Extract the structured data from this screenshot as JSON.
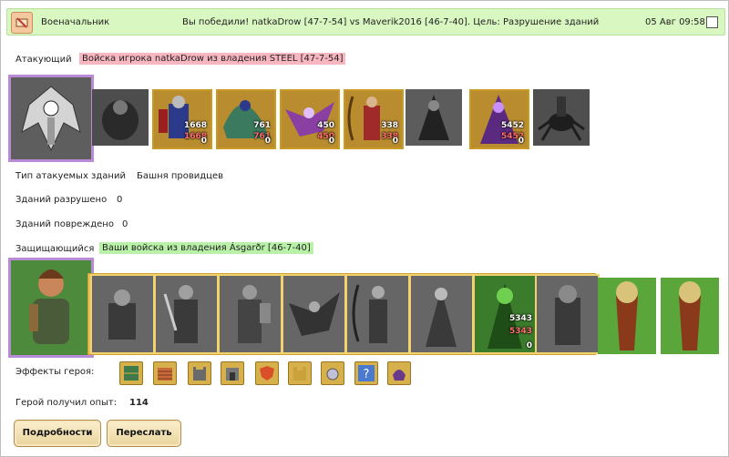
{
  "header": {
    "sender": "Военачальник",
    "subject": "Вы победили! natkaDrow [47-7-54] vs Maverik2016 [46-7-40]. Цель: Разрушение зданий",
    "date": "05 Авг 09:58",
    "icon": "scroll-icon",
    "accent": "#d9f7c0"
  },
  "attacker": {
    "label": "Атакующий",
    "banner": "Войска игрока natkaDrow из владения STEEL [47-7-54]",
    "banner_color": "#f8b6c0",
    "units": [
      {
        "name": "dark-golem",
        "count": null,
        "lost": null,
        "left": null
      },
      {
        "name": "blue-knight",
        "count": "1668",
        "lost": "1668",
        "left": "0"
      },
      {
        "name": "blue-dragon-rider",
        "count": "761",
        "lost": "761",
        "left": "0"
      },
      {
        "name": "purple-griffin",
        "count": "450",
        "lost": "450",
        "left": "0"
      },
      {
        "name": "blue-archer",
        "count": "338",
        "lost": "338",
        "left": "0"
      },
      {
        "name": "dark-monk",
        "count": null,
        "lost": null,
        "left": null
      },
      {
        "name": "purple-mage",
        "count": "5452",
        "lost": "5452",
        "left": "0"
      },
      {
        "name": "dark-spider",
        "count": null,
        "lost": null,
        "left": null
      }
    ]
  },
  "stats": {
    "target_label": "Тип атакуемых зданий",
    "target_value": "Башня провидцев",
    "destroyed_label": "Зданий разрушено",
    "destroyed_value": "0",
    "damaged_label": "Зданий повреждено",
    "damaged_value": "0"
  },
  "defender": {
    "label": "Защищающийся",
    "banner": "Ваши войска из владения Ásgarðr [46-7-40]",
    "banner_color": "#b9f1a9",
    "units": [
      {
        "name": "grey-dwarf",
        "count": null,
        "lost": null,
        "left": null
      },
      {
        "name": "grey-warrior",
        "count": null,
        "lost": null,
        "left": null
      },
      {
        "name": "grey-paladin",
        "count": null,
        "lost": null,
        "left": null
      },
      {
        "name": "grey-griffin",
        "count": null,
        "lost": null,
        "left": null
      },
      {
        "name": "grey-archer",
        "count": null,
        "lost": null,
        "left": null
      },
      {
        "name": "grey-priestess",
        "count": null,
        "lost": null,
        "left": null
      },
      {
        "name": "green-druid",
        "count": "5343",
        "lost": "5343",
        "left": "0"
      },
      {
        "name": "grey-ent",
        "count": null,
        "lost": null,
        "left": null
      }
    ],
    "buildings": [
      "tower-building",
      "tower-building"
    ]
  },
  "effects": {
    "label": "Эффекты героя:",
    "icons": [
      "bookshelf-icon",
      "wall-icon",
      "fortress-icon",
      "gate-icon",
      "shield-icon",
      "castle-icon",
      "amulet-icon",
      "question-icon",
      "helmet-icon"
    ]
  },
  "experience": {
    "label": "Герой получил опыт:",
    "value": "114"
  },
  "buttons": {
    "details": "Подробности",
    "forward": "Переслать"
  }
}
